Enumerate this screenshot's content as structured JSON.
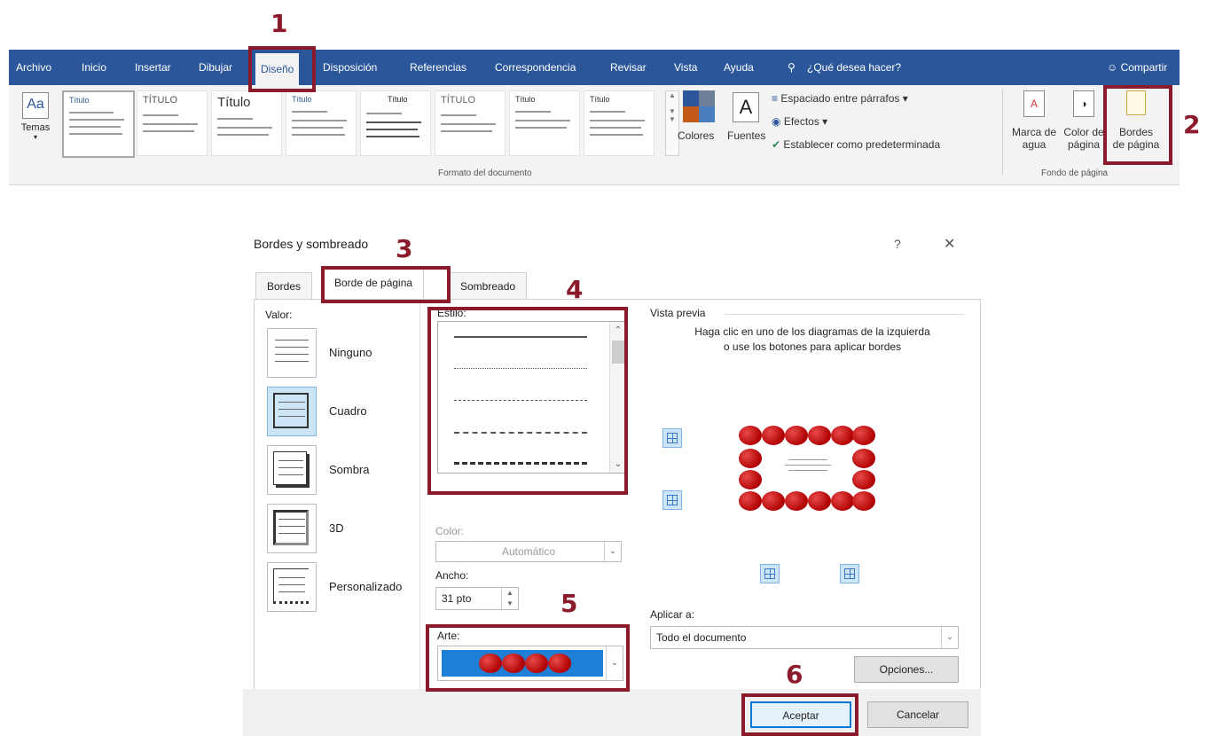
{
  "ribbon": {
    "tabs": [
      "Archivo",
      "Inicio",
      "Insertar",
      "Dibujar",
      "Diseño",
      "Disposición",
      "Referencias",
      "Correspondencia",
      "Revisar",
      "Vista",
      "Ayuda"
    ],
    "search_text": "¿Qué desea hacer?",
    "share_label": "Compartir",
    "themes_label": "Temas",
    "gallery_titles": [
      "Título",
      "TÍTULO",
      "Título",
      "Título",
      "Título",
      "TÍTULO",
      "Título",
      "Título"
    ],
    "colors_label": "Colores",
    "fonts_label": "Fuentes",
    "paragraph_spacing": "Espaciado entre párrafos",
    "effects": "Efectos",
    "set_default": "Establecer como predeterminada",
    "doc_format_group": "Formato del documento",
    "watermark": [
      "Marca de",
      "agua"
    ],
    "page_color": [
      "Color de",
      "página"
    ],
    "page_borders": [
      "Bordes",
      "de página"
    ],
    "page_bg_group": "Fondo de página"
  },
  "annotations": {
    "n1": "1",
    "n2": "2",
    "n3": "3",
    "n4": "4",
    "n5": "5",
    "n6": "6"
  },
  "dialog": {
    "title": "Bordes y sombreado",
    "help": "?",
    "close": "✕",
    "tabs": [
      "Bordes",
      "Borde de página",
      "Sombreado"
    ],
    "valor_label": "Valor:",
    "valor_items": [
      "Ninguno",
      "Cuadro",
      "Sombra",
      "3D",
      "Personalizado"
    ],
    "estilo_label": "Estilo:",
    "color_label": "Color:",
    "color_value": "Automático",
    "ancho_label": "Ancho:",
    "ancho_value": "31 pto",
    "arte_label": "Arte:",
    "preview_label": "Vista previa",
    "preview_hint": "Haga clic en uno de los diagramas de la izquierda o use los botones para aplicar bordes",
    "apply_label": "Aplicar a:",
    "apply_value": "Todo el documento",
    "options_btn": "Opciones...",
    "ok_btn": "Aceptar",
    "cancel_btn": "Cancelar"
  },
  "colors": {
    "ribbon": "#2b579a",
    "annotation": "#8b1a2b",
    "art_blue": "#1e7fd6",
    "apple_red": "#c00000"
  }
}
